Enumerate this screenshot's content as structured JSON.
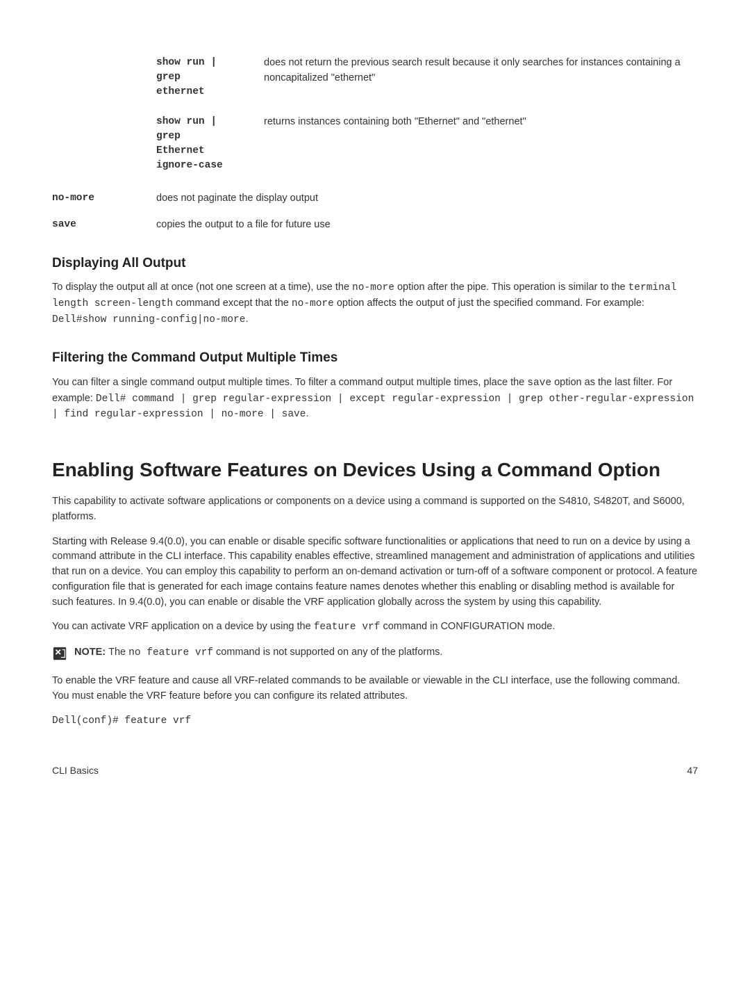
{
  "defs": {
    "nested1": {
      "cmd": "show run |\ngrep\nethernet",
      "desc": "does not return the previous search result because it only searches for instances containing a noncapitalized \"ethernet\""
    },
    "nested2": {
      "cmd": "show run |\ngrep\nEthernet\nignore-case",
      "desc": "returns instances containing both \"Ethernet\" and \"ethernet\""
    },
    "nomore": {
      "term": "no-more",
      "desc": "does not paginate the display output"
    },
    "save": {
      "term": "save",
      "desc": "copies the output to a file for future use"
    }
  },
  "sec1": {
    "heading": "Displaying All Output",
    "p1_a": "To display the output all at once (not one screen at a time), use the ",
    "p1_code1": "no-more",
    "p1_b": " option after the pipe. This operation is similar to the ",
    "p1_code2": "terminal length screen-length",
    "p1_c": " command except that the ",
    "p1_code3": "no-more",
    "p1_d": " option affects the output of just the specified command. For example: ",
    "p1_code4": "Dell#show running-config|no-more",
    "p1_e": "."
  },
  "sec2": {
    "heading": "Filtering the Command Output Multiple Times",
    "p1_a": "You can filter a single command output multiple times. To filter a command output multiple times, place the ",
    "p1_code1": "save",
    "p1_b": " option as the last filter. For example: ",
    "p1_code2": "Dell# command | grep regular-expression | except regular-expression | grep other-regular-expression | find regular-expression | no-more | save",
    "p1_c": "."
  },
  "sec3": {
    "heading": "Enabling Software Features on Devices Using a Command Option",
    "p1": "This capability to activate software applications or components on a device using a command is supported on the S4810, S4820T, and S6000, platforms.",
    "p2": "Starting with Release 9.4(0.0), you can enable or disable specific software functionalities or applications that need to run on a device by using a command attribute in the CLI interface. This capability enables effective, streamlined management and administration of applications and utilities that run on a device. You can employ this capability to perform an on-demand activation or turn-off of a software component or protocol. A feature configuration file that is generated for each image contains feature names denotes whether this enabling or disabling method is available for such features. In 9.4(0.0), you can enable or disable the VRF application globally across the system by using this capability.",
    "p3_a": "You can activate VRF application on a device by using the ",
    "p3_code1": "feature vrf",
    "p3_b": " command in CONFIGURATION mode.",
    "note_label": "NOTE: ",
    "note_a": "The ",
    "note_code": "no feature vrf",
    "note_b": " command is not supported on any of the platforms.",
    "p4": "To enable the VRF feature and cause all VRF-related commands to be available or viewable in the CLI interface, use the following command. You must enable the VRF feature before you can configure its related attributes.",
    "code": "Dell(conf)# feature vrf"
  },
  "footer": {
    "left": "CLI Basics",
    "right": "47"
  }
}
